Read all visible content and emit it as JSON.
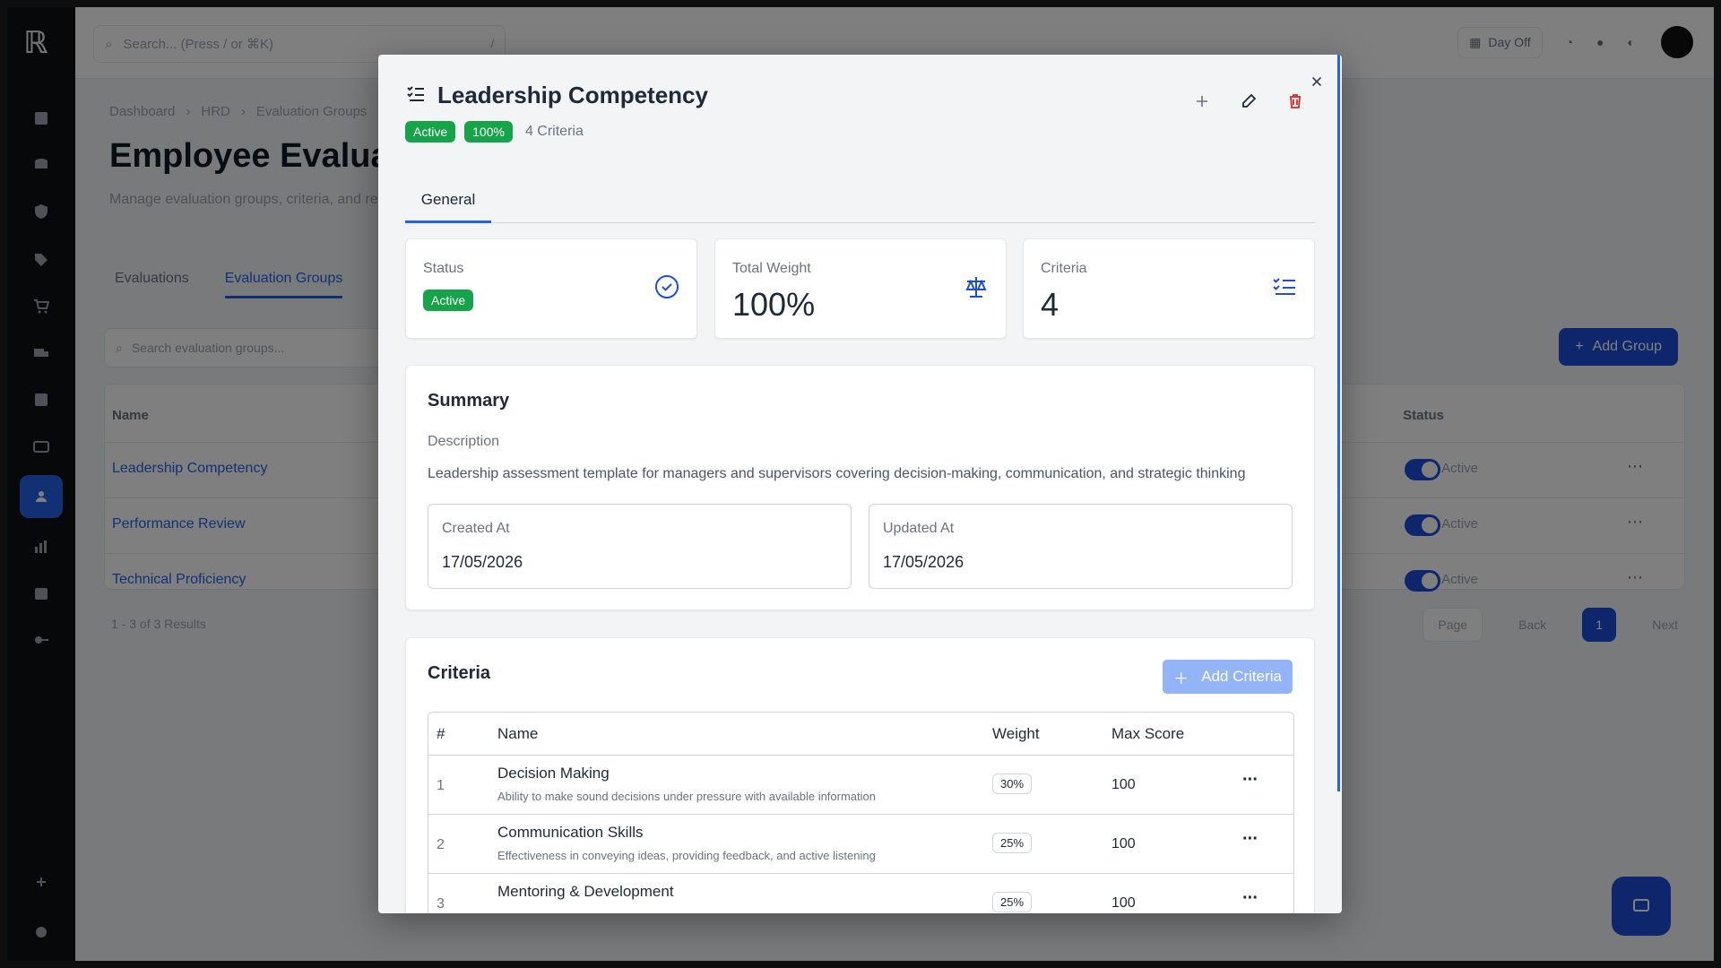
{
  "background": {
    "search": {
      "placeholder": "Search... (Press / or ⌘K)"
    },
    "topbar": {
      "day_off": "Day Off"
    },
    "breadcrumbs": [
      "Dashboard",
      "HRD",
      "Evaluation Groups"
    ],
    "page_title": "Employee Evaluations",
    "page_subtitle": "Manage evaluation groups, criteria, and reviews",
    "tabs": [
      "Evaluations",
      "Evaluation Groups"
    ],
    "search_groups": "Search evaluation groups...",
    "add_group": "Add Group",
    "table": {
      "headers": {
        "name": "Name",
        "status": "Status"
      },
      "rows": [
        {
          "name": "Leadership Competency",
          "status": "Active"
        },
        {
          "name": "Performance Review",
          "status": "Active"
        },
        {
          "name": "Technical Proficiency",
          "status": "Active"
        }
      ]
    },
    "results": "1 - 3 of 3 Results",
    "pager": {
      "per_page": "Page",
      "back": "Back",
      "page": "1",
      "next": "Next"
    }
  },
  "modal": {
    "title": "Leadership Competency",
    "status_badge": "Active",
    "weight_badge": "100%",
    "criteria_count": "4 Criteria",
    "tab": "General",
    "stats": {
      "status_label": "Status",
      "status_value": "Active",
      "weight_label": "Total Weight",
      "weight_value": "100%",
      "criteria_label": "Criteria",
      "criteria_value": "4"
    },
    "summary": {
      "title": "Summary",
      "description_label": "Description",
      "description": "Leadership assessment template for managers and supervisors covering decision-making, communication, and strategic thinking",
      "created_label": "Created At",
      "created_value": "17/05/2026",
      "updated_label": "Updated At",
      "updated_value": "17/05/2026"
    },
    "criteria": {
      "title": "Criteria",
      "add_label": "Add Criteria",
      "headers": {
        "index": "#",
        "name": "Name",
        "weight": "Weight",
        "max_score": "Max Score"
      },
      "rows": [
        {
          "index": "1",
          "name": "Decision Making",
          "description": "Ability to make sound decisions under pressure with available information",
          "weight": "30%",
          "max_score": "100"
        },
        {
          "index": "2",
          "name": "Communication Skills",
          "description": "Effectiveness in conveying ideas, providing feedback, and active listening",
          "weight": "25%",
          "max_score": "100"
        },
        {
          "index": "3",
          "name": "Mentoring & Development",
          "description": "",
          "weight": "25%",
          "max_score": "100"
        }
      ]
    }
  },
  "colors": {
    "accent": "#2563eb",
    "success": "#16a34a",
    "danger": "#dc2626"
  }
}
